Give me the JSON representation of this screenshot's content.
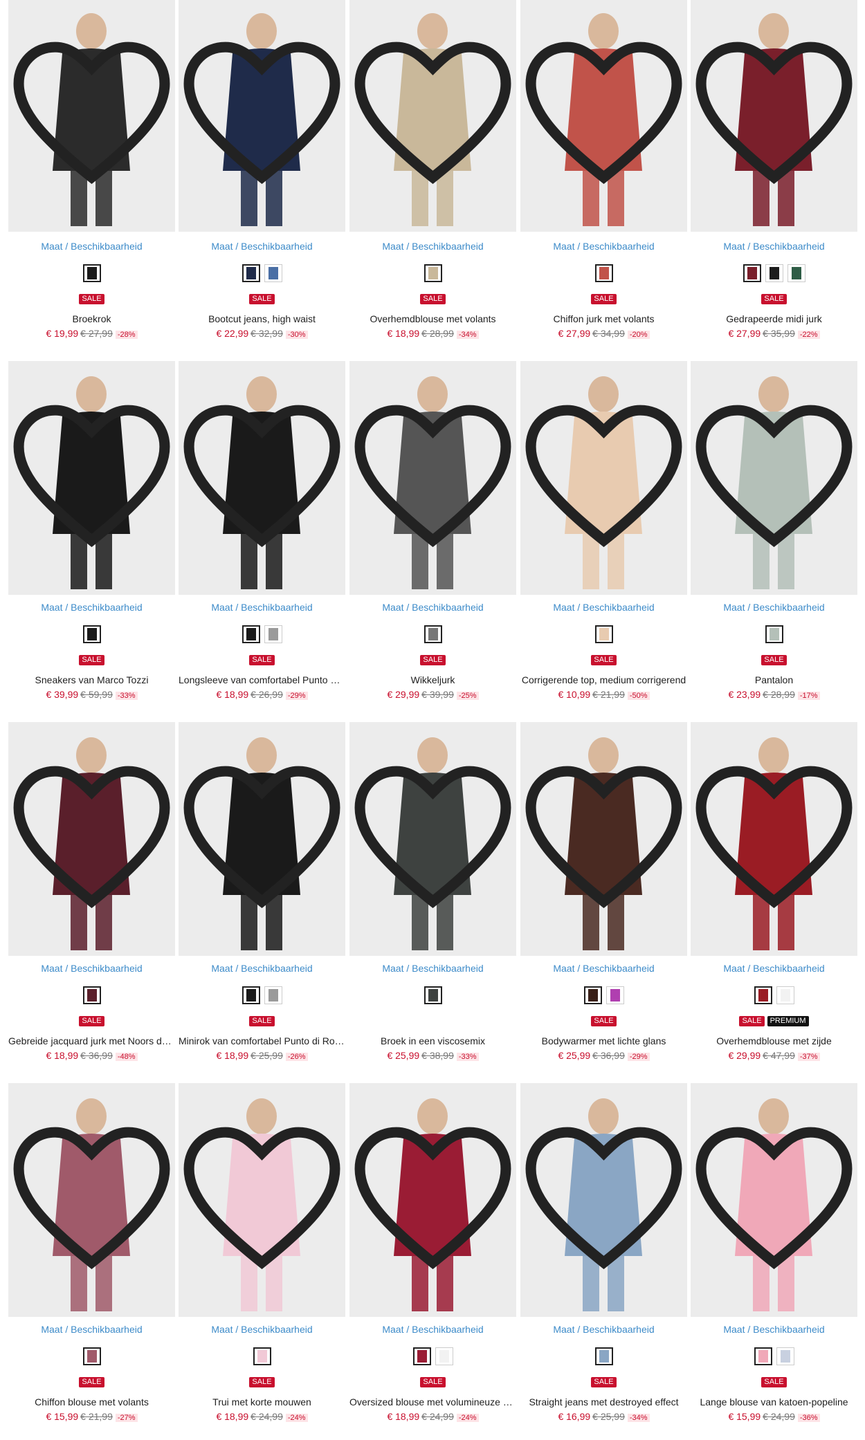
{
  "common": {
    "size_link": "Maat / Beschikbaarheid",
    "sale": "SALE",
    "premium": "PREMIUM",
    "heart_icon": "heart-outline-icon"
  },
  "colors": {
    "sale_red": "#c8102e",
    "link_blue": "#3d8bc9"
  },
  "products": [
    {
      "name": "Broekrok",
      "price": "€ 19,99",
      "old_price": "€ 27,99",
      "discount": "-28%",
      "premium": false,
      "image_tone": "#2b2b2b",
      "swatches": [
        "#1c1c1c"
      ]
    },
    {
      "name": "Bootcut jeans, high waist",
      "price": "€ 22,99",
      "old_price": "€ 32,99",
      "discount": "-30%",
      "premium": false,
      "image_tone": "#1f2b4a",
      "swatches": [
        "#1f2b4a",
        "#4a6fa5"
      ]
    },
    {
      "name": "Overhemdblouse met volants",
      "price": "€ 18,99",
      "old_price": "€ 28,99",
      "discount": "-34%",
      "premium": false,
      "image_tone": "#c9b89a",
      "swatches": [
        "#c9b89a"
      ]
    },
    {
      "name": "Chiffon jurk met volants",
      "price": "€ 27,99",
      "old_price": "€ 34,99",
      "discount": "-20%",
      "premium": false,
      "image_tone": "#c1534a",
      "swatches": [
        "#c1534a"
      ]
    },
    {
      "name": "Gedrapeerde midi jurk",
      "price": "€ 27,99",
      "old_price": "€ 35,99",
      "discount": "-22%",
      "premium": false,
      "image_tone": "#7a1f2b",
      "swatches": [
        "#7a1f2b",
        "#1c1c1c",
        "#2f5d46"
      ]
    },
    {
      "name": "Sneakers van Marco Tozzi",
      "price": "€ 39,99",
      "old_price": "€ 59,99",
      "discount": "-33%",
      "premium": false,
      "image_tone": "#1a1a1a",
      "swatches": [
        "#1a1a1a"
      ]
    },
    {
      "name": "Longsleeve van comfortabel Punto di Roma",
      "price": "€ 18,99",
      "old_price": "€ 26,99",
      "discount": "-29%",
      "premium": false,
      "image_tone": "#1a1a1a",
      "swatches": [
        "#1a1a1a",
        "#9a9a9a"
      ]
    },
    {
      "name": "Wikkeljurk",
      "price": "€ 29,99",
      "old_price": "€ 39,99",
      "discount": "-25%",
      "premium": false,
      "image_tone": "#555555",
      "swatches": [
        "#777777"
      ]
    },
    {
      "name": "Corrigerende top, medium corrigerend",
      "price": "€ 10,99",
      "old_price": "€ 21,99",
      "discount": "-50%",
      "premium": false,
      "image_tone": "#e8cbb0",
      "swatches": [
        "#e8cbb0"
      ]
    },
    {
      "name": "Pantalon",
      "price": "€ 23,99",
      "old_price": "€ 28,99",
      "discount": "-17%",
      "premium": false,
      "image_tone": "#b4c0b8",
      "swatches": [
        "#b4c0b8"
      ]
    },
    {
      "name": "Gebreide jacquard jurk met Noors dessin",
      "price": "€ 18,99",
      "old_price": "€ 36,99",
      "discount": "-48%",
      "premium": false,
      "image_tone": "#5a1f2b",
      "swatches": [
        "#5a1f2b"
      ]
    },
    {
      "name": "Minirok van comfortabel Punto di Roma",
      "price": "€ 18,99",
      "old_price": "€ 25,99",
      "discount": "-26%",
      "premium": false,
      "image_tone": "#1a1a1a",
      "swatches": [
        "#1a1a1a",
        "#9a9a9a"
      ]
    },
    {
      "name": "Broek in een viscosemix",
      "price": "€ 25,99",
      "old_price": "€ 38,99",
      "discount": "-33%",
      "premium": false,
      "sale_hidden": true,
      "image_tone": "#3e4240",
      "swatches": [
        "#3e4240"
      ]
    },
    {
      "name": "Bodywarmer met lichte glans",
      "price": "€ 25,99",
      "old_price": "€ 36,99",
      "discount": "-29%",
      "premium": false,
      "image_tone": "#4a2a22",
      "swatches": [
        "#3a2018",
        "#b03fb0"
      ]
    },
    {
      "name": "Overhemdblouse met zijde",
      "price": "€ 29,99",
      "old_price": "€ 47,99",
      "discount": "-37%",
      "premium": true,
      "image_tone": "#9a1c24",
      "swatches": [
        "#9a1c24",
        "#f2f2f2"
      ]
    },
    {
      "name": "Chiffon blouse met volants",
      "price": "€ 15,99",
      "old_price": "€ 21,99",
      "discount": "-27%",
      "premium": false,
      "image_tone": "#a05a6a",
      "swatches": [
        "#a05a6a"
      ]
    },
    {
      "name": "Trui met korte mouwen",
      "price": "€ 18,99",
      "old_price": "€ 24,99",
      "discount": "-24%",
      "premium": false,
      "image_tone": "#f1c9d6",
      "swatches": [
        "#f1c9d6"
      ]
    },
    {
      "name": "Oversized blouse met volumineuze mouwen",
      "price": "€ 18,99",
      "old_price": "€ 24,99",
      "discount": "-24%",
      "premium": false,
      "image_tone": "#9a1c34",
      "swatches": [
        "#9a1c34",
        "#f2f2f2"
      ]
    },
    {
      "name": "Straight jeans met destroyed effect",
      "price": "€ 16,99",
      "old_price": "€ 25,99",
      "discount": "-34%",
      "premium": false,
      "image_tone": "#8aa6c4",
      "swatches": [
        "#8aa6c4"
      ]
    },
    {
      "name": "Lange blouse van katoen-popeline",
      "price": "€ 15,99",
      "old_price": "€ 24,99",
      "discount": "-36%",
      "premium": false,
      "image_tone": "#f0a8b8",
      "swatches": [
        "#f0a8b8",
        "#c8d0e0"
      ]
    }
  ]
}
